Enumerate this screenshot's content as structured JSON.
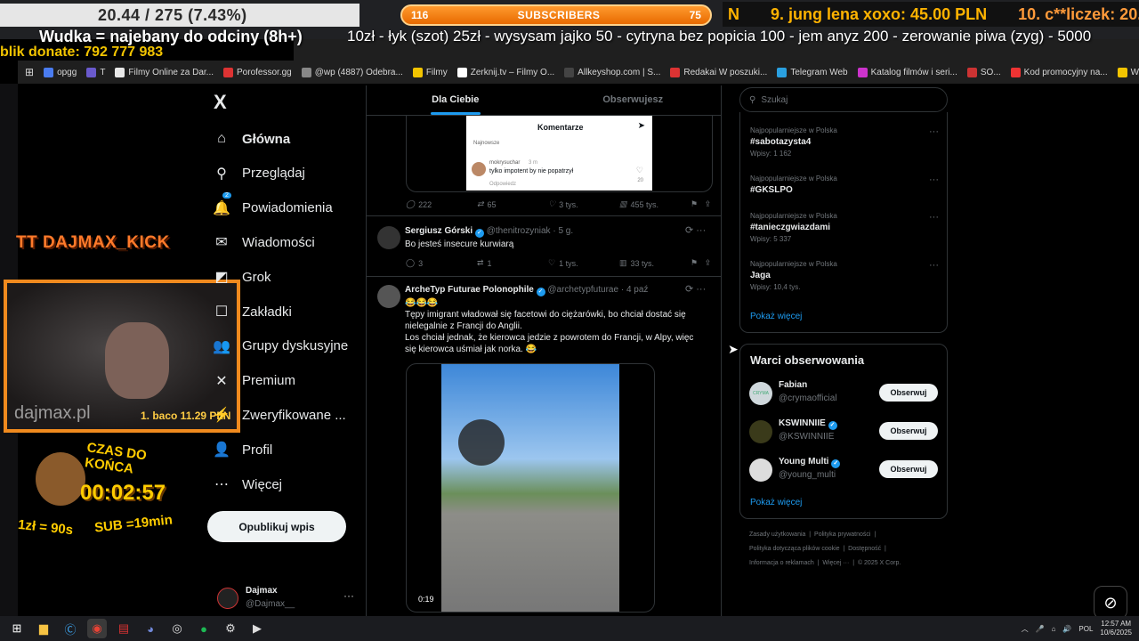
{
  "stream": {
    "progress": "20.44 / 275 (7.43%)",
    "subs": {
      "left": "116",
      "label": "SUBSCRIBERS",
      "right": "75"
    },
    "top": [
      "N",
      "9. jung lena xoxo: 45.00 PLN",
      "10. c**liczek: 20.00 PLN"
    ],
    "wudka": "Wudka = najebany do odciny (8h+)",
    "ticker": "10zł - łyk (szot) 25zł - wysysam jajko 50 - cytryna bez popicia 100 - jem anyz 200 - zerowanie piwa (zyg) - 5000",
    "blik": "blik donate: 792 777 983",
    "tt": "TT DAJMAX_KICK",
    "cam_wm": "dajmax.pl",
    "cam_don": "1. baco 11.29 PLN",
    "timer": {
      "title": "CZAS DO KOŃCA",
      "time": "00:02:57",
      "rate1": "1zł = 90s",
      "rate2": "SUB =19min"
    }
  },
  "bookmarks": [
    "opgg",
    "T",
    "Filmy Online za Dar...",
    "Porofessor.gg",
    "@wp (4887) Odebra...",
    "Filmy",
    "Zerknij.tv – Filmy O...",
    "Allkeyshop.com | S...",
    "Redakai W poszuki...",
    "Telegram Web",
    "Katalog filmów i seri...",
    "SO...",
    "Kod promocyjny na...",
    "Wszystkie zakładki"
  ],
  "nav": {
    "logo": "X",
    "items": [
      {
        "label": "Główna",
        "icon": "home-icon",
        "glyph": "⌂"
      },
      {
        "label": "Przeglądaj",
        "icon": "search-icon",
        "glyph": "⚲"
      },
      {
        "label": "Powiadomienia",
        "icon": "bell-icon",
        "glyph": "🔔",
        "badge": "2"
      },
      {
        "label": "Wiadomości",
        "icon": "mail-icon",
        "glyph": "✉"
      },
      {
        "label": "Grok",
        "icon": "grok-icon",
        "glyph": "◩"
      },
      {
        "label": "Zakładki",
        "icon": "bookmark-icon",
        "glyph": "☐"
      },
      {
        "label": "Grupy dyskusyjne",
        "icon": "groups-icon",
        "glyph": "👥"
      },
      {
        "label": "Premium",
        "icon": "premium-icon",
        "glyph": "✕"
      },
      {
        "label": "Zweryfikowane ...",
        "icon": "verified-org-icon",
        "glyph": "⚡"
      },
      {
        "label": "Profil",
        "icon": "profile-icon",
        "glyph": "👤"
      },
      {
        "label": "Więcej",
        "icon": "more-icon",
        "glyph": "⋯"
      }
    ],
    "post": "Opublikuj wpis",
    "account": {
      "name": "Dajmax",
      "handle": "@Dajmax__"
    }
  },
  "tabs": [
    "Dla Ciebie",
    "Obserwujesz"
  ],
  "embed": {
    "title": "Komentarze",
    "sort": "Najnowsze",
    "user": "mokrysuchar",
    "time": "3 m",
    "text": "tylko impotent by nie popatrzył",
    "reply": "Odpowiedz",
    "likes": "20"
  },
  "tweet1_actions": {
    "reply": "222",
    "rt": "65",
    "like": "3 tys.",
    "views": "455 tys."
  },
  "tweet2": {
    "name": "Sergiusz Górski",
    "handle": "@thenitrozyniak",
    "time": "5 g.",
    "text": "Bo jesteś insecure kurwiarą",
    "reply": "3",
    "rt": "1",
    "like": "1 tys.",
    "views": "33 tys."
  },
  "tweet3": {
    "name": "ArcheTyp Futurae Polonophile",
    "handle": "@archetypfuturae",
    "time": "4 paź",
    "line1": "😂😂😂",
    "line2": "Tępy imigrant władował się facetowi do ciężarówki, bo chciał dostać się",
    "line3": "nielegalnie z Francji do Anglii.",
    "line4": "Los chciał jednak, że kierowca jedzie z powrotem do Francji, w Alpy, więc",
    "line5": "się kierowca uśmiał jak norka. 😂",
    "duration": "0:19"
  },
  "search_placeholder": "Szukaj",
  "trends": [
    {
      "ctx": "Najpopularniejsze w Polska",
      "tag": "#sabotazysta4",
      "count": "Wpisy: 1 162"
    },
    {
      "ctx": "Najpopularniejsze w Polska",
      "tag": "#GKSLPO",
      "count": ""
    },
    {
      "ctx": "Najpopularniejsze w Polska",
      "tag": "#tanieczgwiazdami",
      "count": "Wpisy: 5 337"
    },
    {
      "ctx": "Najpopularniejsze w Polska",
      "tag": "Jaga",
      "count": "Wpisy: 10,4 tys."
    }
  ],
  "show_more": "Pokaż więcej",
  "follow_title": "Warci obserwowania",
  "follow": [
    {
      "name": "Fabian",
      "handle": "@crymaofficial",
      "btn": "Obserwuj",
      "verified": false
    },
    {
      "name": "KSWINNIIE",
      "handle": "@KSWINNIIE",
      "btn": "Obserwuj",
      "verified": true
    },
    {
      "name": "Young Multi",
      "handle": "@young_multi",
      "btn": "Obserwuj",
      "verified": true
    }
  ],
  "footer": {
    "l1a": "Zasady użytkowania",
    "l1b": "Polityka prywatności",
    "l2a": "Polityka dotycząca plików cookie",
    "l2b": "Dostępność",
    "l3a": "Informacja o reklamach",
    "l3b": "Więcej ···",
    "l3c": "© 2025 X Corp."
  },
  "tray": {
    "lang": "POL",
    "time": "12:57 AM",
    "date": "10/6/2025"
  },
  "colors": {
    "accent": "#1d9bf0",
    "orange": "#f08a1e",
    "gold": "#ffb300"
  }
}
